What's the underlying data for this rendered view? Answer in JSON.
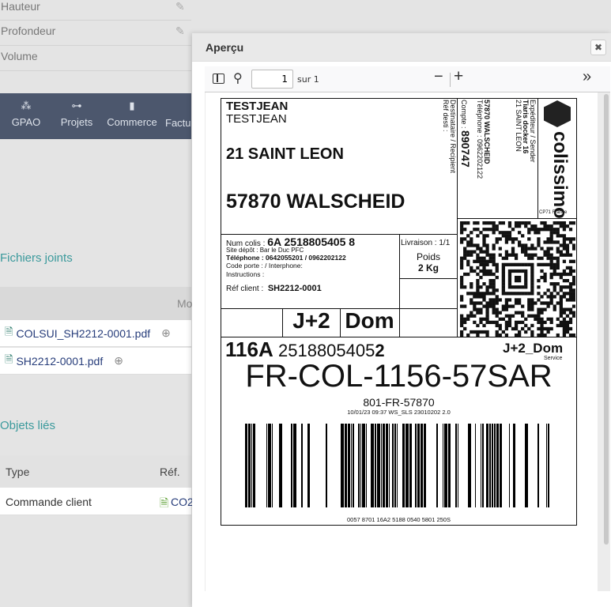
{
  "left": {
    "fields": [
      "Hauteur",
      "Profondeur",
      "Volume"
    ],
    "nav": [
      {
        "icon": "cubes-icon",
        "glyph": "⁂",
        "label": "GPAO"
      },
      {
        "icon": "project-tree-icon",
        "glyph": "⊶",
        "label": "Projets"
      },
      {
        "icon": "briefcase-icon",
        "glyph": "▮",
        "label": "Commerce"
      },
      {
        "icon": "invoice-icon",
        "glyph": "",
        "label": "Factur"
      }
    ],
    "attached_title": "Fichiers joints",
    "attached_col": "Mo",
    "files": [
      "COLSUI_SH2212-0001.pdf",
      "SH2212-0001.pdf"
    ],
    "linked_title": "Objets liés",
    "linked_cols": [
      "Type",
      "Réf."
    ],
    "linked_rows": [
      {
        "type": "Commande client",
        "ref": "CO2"
      }
    ]
  },
  "dialog": {
    "title": "Aperçu",
    "close": "✖",
    "toolbar": {
      "page": "1",
      "of": "sur 1",
      "zoom_out": "−",
      "zoom_in": "+",
      "more": "»"
    }
  },
  "label": {
    "name1": "TESTJEAN",
    "name2": "TESTJEAN",
    "street": "21 SAINT LEON",
    "city": "57870 WALSCHEID",
    "dest_label": "Destinataire / Recipient",
    "ref_desti": "Réf desti :",
    "compte_label": "Compte :",
    "compte": "890747",
    "dest_city": "57870 WALSCHEID",
    "dest_tel": "Téléphone : 0962202122",
    "sender_label": "Expéditeur / Sender",
    "sender_name": "Tiaris docker 16",
    "sender_street": "21 SAINT LEON",
    "brand": "colissimo",
    "brand_sub": "CP71 France",
    "num_colis_label": "Num colis :",
    "num_colis": "6A 2518805405 8",
    "site": "Site dépôt : Bar le Duc PFC",
    "tel": "Téléphone : 0642055201 / 0962202122",
    "code": "Code porte : / Interphone:",
    "instr": "Instructions :",
    "ref_label": "Réf client :",
    "ref": "SH2212-0001",
    "livraison": "Livraison : 1/1",
    "poids_label": "Poids",
    "poids": "2 Kg",
    "j2": "J+2",
    "dom": "Dom",
    "code116": "116A",
    "code_num": "2518805405",
    "code_end": "2",
    "service": "J+2_Dom",
    "service_label": "Service",
    "routing": "FR-COL-1156-57SAR",
    "sort": "801-FR-57870",
    "stamp": "10/01/23 09:37 WS_SLS 23010202 2.0",
    "barcode_text": "0057 8701 16A2 5188 0540 5801 250S"
  }
}
